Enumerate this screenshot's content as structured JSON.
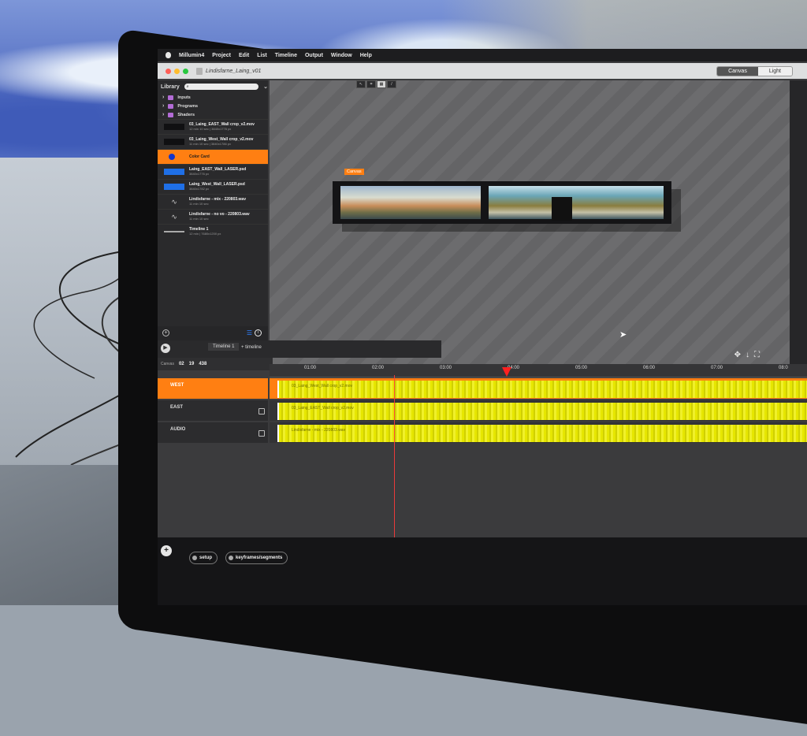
{
  "app": {
    "name": "Millumin4",
    "menu": [
      "Millumin4",
      "Project",
      "Edit",
      "List",
      "Timeline",
      "Output",
      "Window",
      "Help"
    ],
    "document_title": "Lindisfarne_Laing_v01",
    "view_modes": [
      "Canvas",
      "Light"
    ],
    "active_view_mode": "Canvas"
  },
  "library": {
    "title": "Library",
    "folders": [
      "Inputs",
      "Programs",
      "Shaders"
    ],
    "media": [
      {
        "name": "03_Laing_EAST_Wall crop_v2.mov",
        "meta": "12 min 10 sec | 3840x1776 px",
        "thumb": "dark"
      },
      {
        "name": "03_Laing_West_Wall crop_v2.mov",
        "meta": "11 min 10 sec | 3840x1786 px",
        "thumb": "dark"
      },
      {
        "name": "Color Card",
        "meta": "",
        "thumb": "dot",
        "selected": true
      },
      {
        "name": "Laing_EAST_Wall_LASER.psd",
        "meta": "3840x1776 px",
        "thumb": "blue"
      },
      {
        "name": "Laing_West_Wall_LASER.psd",
        "meta": "3840x1782 px",
        "thumb": "blue"
      },
      {
        "name": "Lindisfarne - mix - 220803.wav",
        "meta": "11 min 10 sec",
        "thumb": "wave"
      },
      {
        "name": "Lindisfarne - no vo - 220803.wav",
        "meta": "11 min 10 sec",
        "thumb": "wave"
      },
      {
        "name": "Timeline 1",
        "meta": "12 min | 7680x1200 px",
        "thumb": "line"
      }
    ]
  },
  "canvas": {
    "tag": "Canvas",
    "tools": [
      "pointer",
      "crop",
      "grid",
      "pen"
    ]
  },
  "timeline": {
    "tabs": [
      "Timeline 1",
      "+ timeline"
    ],
    "active_tab": "Timeline 1",
    "counters": [
      "02",
      "19",
      "438"
    ],
    "canvas_label": "Canvas",
    "ruler": [
      "01:00",
      "02:00",
      "03:00",
      "04:00",
      "05:00",
      "06:00",
      "07:00",
      "08:0"
    ],
    "tracks": [
      {
        "label": "WEST",
        "clip": "03_Laing_West_Wall crop_v2.mov",
        "selected": true
      },
      {
        "label": "EAST",
        "clip": "03_Laing_EAST_Wall crop_v2.mov",
        "selected": false
      },
      {
        "label": "AUDIO",
        "clip": "Lindisfarne - mix - 220803.wav",
        "selected": false
      }
    ]
  },
  "bottom": {
    "buttons": [
      "setup",
      "keyframes/segments"
    ]
  },
  "colors": {
    "accent": "#ff7f12",
    "clip": "#e6e600",
    "playhead": "#ff2020"
  }
}
